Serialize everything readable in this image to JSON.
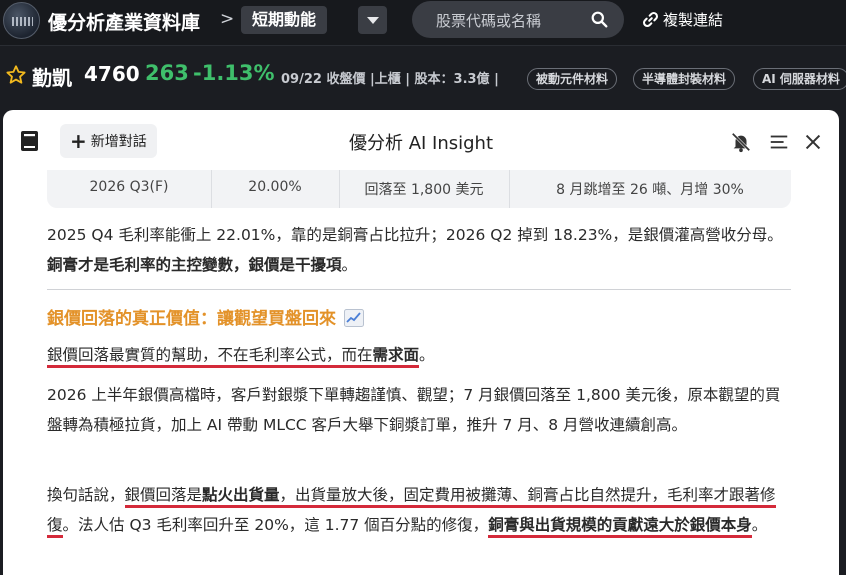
{
  "topbar": {
    "app_title": "優分析產業資料庫",
    "crumb_sep": ">",
    "crumb": "短期動能",
    "search_placeholder": "股票代碼或名稱",
    "copy_link": "複製連結"
  },
  "stock": {
    "name": "勤凱",
    "code": "4760",
    "price": "263",
    "change": "-1.13%",
    "meta": "09/22 收盤價 |上櫃 | 股本：3.3億 |",
    "tags": [
      "被動元件材料",
      "半導體封裝材料",
      "AI 伺服器材料"
    ],
    "change_color": "#3fbf6b"
  },
  "panel": {
    "new_chat_label": "新增對話",
    "title": "優分析 AI Insight",
    "table_row": [
      "2026 Q3(F)",
      "20.00%",
      "回落至 1,800 美元",
      "8 月跳增至 26 噸、月增 30%"
    ],
    "p1_a": "2025 Q4 毛利率能衝上 22.01%，靠的是銅膏占比拉升；2026 Q2 掉到 18.23%，是銀價灌高營收分母。",
    "p1_b": "銅膏才是毛利率的主控變數，銀價是干擾項",
    "p1_c": "。",
    "heading": "銀價回落的真正價值：讓觀望買盤回來",
    "p2_a": "銀價回落最實質的幫助，不在毛利率公式，而在",
    "p2_b": "需求面",
    "p2_c": "。",
    "p3": "2026 上半年銀價高檔時，客戶對銀漿下單轉趨謹慎、觀望；7 月銀價回落至 1,800 美元後，原本觀望的買盤轉為積極拉貨，加上 AI 帶動 MLCC 客戶大舉下銅漿訂單，推升 7 月、8 月營收連續創高。",
    "p4_a": "換句話說，",
    "p4_b": "銀價回落是",
    "p4_c": "點火出貨量",
    "p4_d": "，出貨量放大後，固定費用被攤薄、銅膏占比自然提升，毛利率才跟著修復",
    "p4_e": "。法人估 Q3 毛利率回升至 20%，這 1.77 個百分點的修復，",
    "p4_f": "銅膏與出貨規模的貢獻遠大於銀價本身",
    "p4_g": "。",
    "accent_color": "#e39229",
    "underline_color": "#d42a3a"
  }
}
